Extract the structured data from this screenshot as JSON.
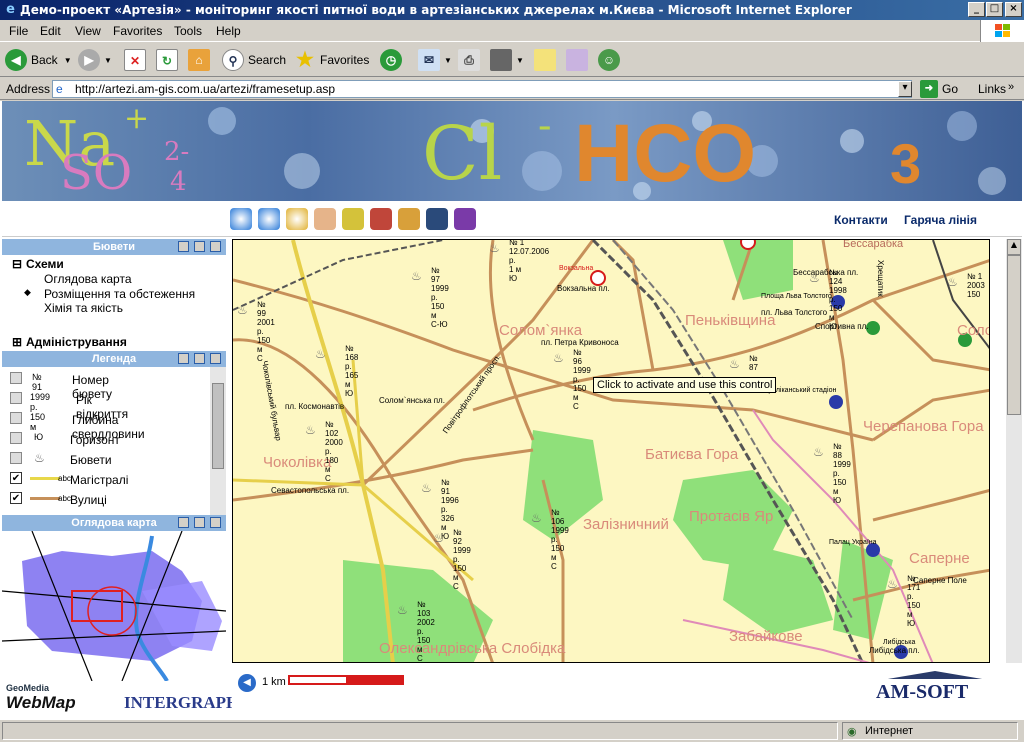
{
  "window": {
    "title": "Демо-проект «Артезія» - моніторинг якості питної води в артезіанських джерелах м.Києва - Microsoft Internet Explorer"
  },
  "menu": [
    "File",
    "Edit",
    "View",
    "Favorites",
    "Tools",
    "Help"
  ],
  "toolbar": {
    "back": "Back",
    "search": "Search",
    "favorites": "Favorites"
  },
  "address": {
    "label": "Address",
    "url": "http://artezi.am-gis.com.ua/artezi/framesetup.asp",
    "go": "Go",
    "links": "Links"
  },
  "banner": {
    "na": "Na",
    "plus": "+",
    "so": "SO",
    "so_sub": "4",
    "so_sup": "2-",
    "cl": "Cl",
    "cl_sup": "-",
    "hco": "HCO",
    "hco_sub": "3"
  },
  "header_links": {
    "contacts": "Контакти",
    "hotline": "Гаряча лінія"
  },
  "left": {
    "boreholes_title": "Бювети",
    "schemes": "Схеми",
    "overview_map": "Оглядова карта",
    "placement": "Розміщення та обстеження",
    "chemistry": "Хімія та якість",
    "admin": "Адміністрування",
    "legend_title": "Легенда",
    "legend": [
      {
        "sample": "№ 91",
        "label": "Номер бювету"
      },
      {
        "sample": "1999 р.",
        "label": "Рік відкриття"
      },
      {
        "sample": "150 м",
        "label": "Глибина свердловини"
      },
      {
        "sample": "Ю",
        "label": "Горизонт"
      },
      {
        "sample": "",
        "label": "Бювети"
      },
      {
        "sample": "abc",
        "label": "Магістралі"
      },
      {
        "sample": "abc",
        "label": "Вулиці"
      }
    ],
    "overview_title": "Оглядова карта"
  },
  "map": {
    "tooltip": "Click to activate and use this control",
    "districts": [
      "Солом`янка",
      "Пеньківщина",
      "Батиєва Гора",
      "Залізничний",
      "Протасів Яр",
      "Забайкове",
      "Олександрівська Слобідка",
      "Чоколівка",
      "Черепанова Гора",
      "Солом`янка",
      "Сапернe"
    ],
    "streets": [
      "пл. Космонавтів",
      "Солом`янська пл.",
      "Севастопольська пл.",
      "пл. Петра Кривоноса",
      "Вокзальна пл.",
      "пл. Льва Толстого",
      "Спортивна пл.",
      "Бессарабська пл.",
      "Либідська пл.",
      "Чоколівський бульвар",
      "Повітрофлотський просп.",
      "Бессарабка",
      "Палац Україна",
      "Республіканський стадіон",
      "Вокзальна",
      "Площа Льва Толстого",
      "Либідська",
      "Хрещатик",
      "Сапернe Поле"
    ],
    "wells": [
      {
        "num": "№ 1",
        "year": "12.07.2006 р.",
        "depth": "1 м",
        "hz": "Ю"
      },
      {
        "num": "№ 97",
        "year": "1999 р.",
        "depth": "150 м",
        "hz": "С-Ю"
      },
      {
        "num": "№ 99",
        "year": "2001 р.",
        "depth": "150 м",
        "hz": "С"
      },
      {
        "num": "№ 168",
        "year": "р.",
        "depth": "165 м",
        "hz": "Ю"
      },
      {
        "num": "№ 96",
        "year": "1999 р.",
        "depth": "150 м",
        "hz": "С"
      },
      {
        "num": "№ 87",
        "year": "",
        "depth": "",
        "hz": ""
      },
      {
        "num": "№ 124",
        "year": "1998 р.",
        "depth": "150 м",
        "hz": "Ю"
      },
      {
        "num": "№ 1",
        "year": "2003",
        "depth": "150",
        "hz": ""
      },
      {
        "num": "№ 102",
        "year": "2000 р.",
        "depth": "180 м",
        "hz": "С"
      },
      {
        "num": "№ 88",
        "year": "1999 р.",
        "depth": "150 м",
        "hz": "Ю"
      },
      {
        "num": "№ 91",
        "year": "1996 р.",
        "depth": "326 м",
        "hz": "Ю"
      },
      {
        "num": "№ 106",
        "year": "1999 р.",
        "depth": "150 м",
        "hz": "С"
      },
      {
        "num": "№ 92",
        "year": "1999 р.",
        "depth": "150 м",
        "hz": "С"
      },
      {
        "num": "№ 103",
        "year": "2002 р.",
        "depth": "150 м",
        "hz": "С"
      },
      {
        "num": "№ 171",
        "year": "р.",
        "depth": "150 м",
        "hz": "Ю"
      }
    ]
  },
  "scale": {
    "label": "1 km"
  },
  "logos": {
    "geomedia": "GeoMedia",
    "webmap": "WebMap",
    "intergraph": "INTERGRAPH",
    "amsoft": "AM-SOFT"
  },
  "status": {
    "zone": "Интернет"
  },
  "colors": {
    "title_bar": "#0a246a",
    "panel_header": "#8fb5de",
    "map_bg": "#fdf7c2",
    "park": "#8fe07a",
    "road": "#c6905a",
    "metro": "#d61a1a"
  }
}
